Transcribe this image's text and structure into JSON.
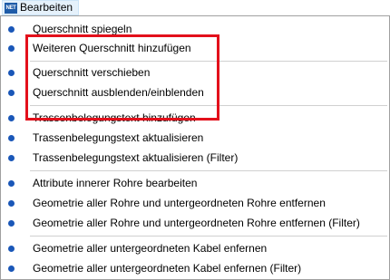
{
  "menubar": {
    "icon_text": "NET",
    "title": "Bearbeiten"
  },
  "menu": {
    "items": [
      {
        "label": "Querschnitt spiegeln"
      },
      {
        "label": "Weiteren Querschnitt hinzufügen"
      },
      {
        "label": "Querschnitt verschieben"
      },
      {
        "label": "Querschnitt ausblenden/einblenden"
      },
      {
        "label": "Trassenbelegungstext hinzufügen"
      },
      {
        "label": "Trassenbelegungstext aktualisieren"
      },
      {
        "label": "Trassenbelegungstext aktualisieren (Filter)"
      },
      {
        "label": "Attribute innerer Rohre bearbeiten"
      },
      {
        "label": "Geometrie aller Rohre und untergeordneten Rohre entfernen"
      },
      {
        "label": "Geometrie aller Rohre und untergeordneten Rohre entfernen (Filter)"
      },
      {
        "label": "Geometrie aller untergeordneten Kabel enfernen"
      },
      {
        "label": "Geometrie aller untergeordneten Kabel enfernen (Filter)"
      }
    ]
  },
  "colors": {
    "bullet": "#1a57b8",
    "highlight": "#e3101b"
  }
}
